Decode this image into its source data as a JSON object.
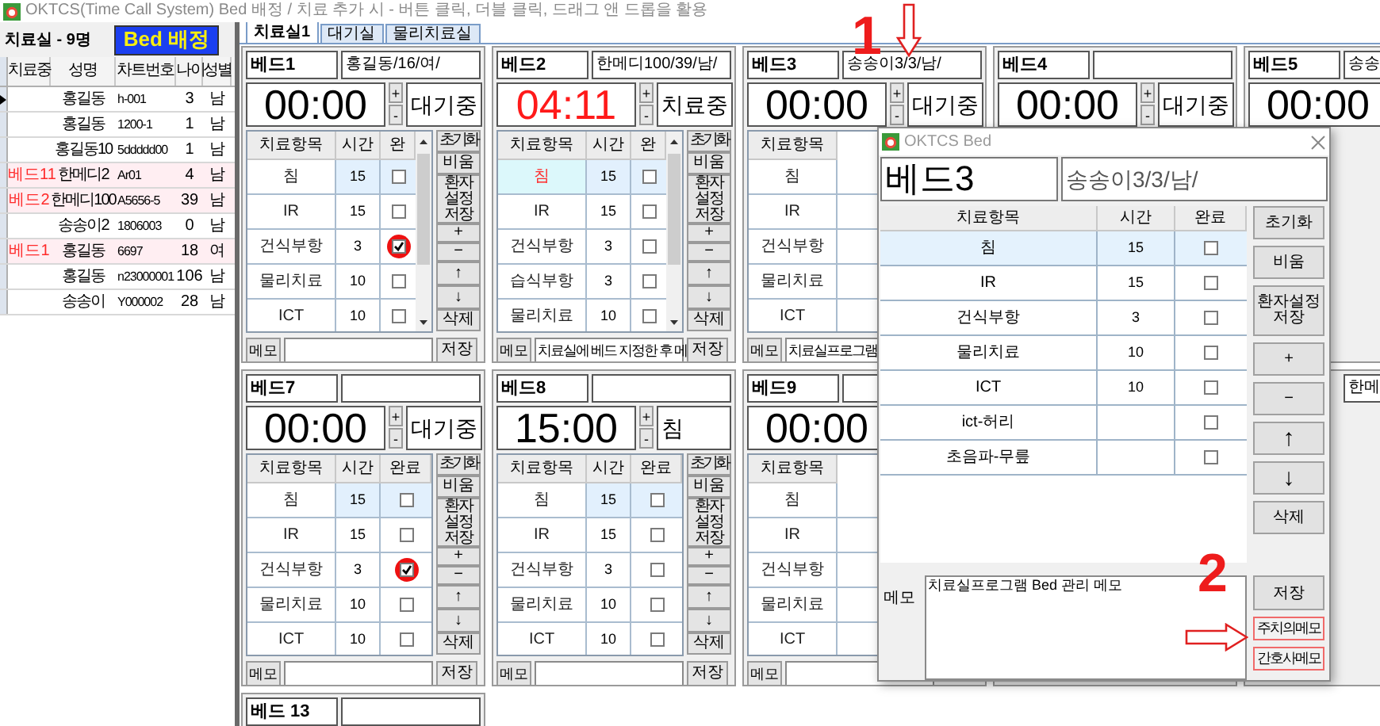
{
  "window": {
    "title": "OKTCS(Time Call System)  Bed 배정 / 치료 추가 시 - 버튼 클릭, 더블 클릭, 드래그 앤 드롭을 활용"
  },
  "patients": {
    "title": "치료실 - 9명",
    "assign_button": "Bed 배정",
    "columns": [
      "치료중",
      "성명",
      "차트번호",
      "나이",
      "성별"
    ],
    "rows": [
      {
        "name": "홍길동",
        "chart": "h-001",
        "age": "3",
        "sex": "남",
        "selected": true
      },
      {
        "name": "홍길동",
        "chart": "1200-1",
        "age": "1",
        "sex": "남",
        "selected": false
      },
      {
        "name": "홍길동10",
        "chart": "5ddddd00",
        "age": "1",
        "sex": "남",
        "selected": false
      },
      {
        "bed": "베드11",
        "name": "한메디2",
        "chart": "Ar01",
        "age": "4",
        "sex": "남",
        "selected": false
      },
      {
        "bed": "베드2",
        "name": "한메디100",
        "chart": "A5656-5",
        "age": "39",
        "sex": "남",
        "selected": false
      },
      {
        "name": "송송이2",
        "chart": "1806003",
        "age": "0",
        "sex": "남",
        "selected": false
      },
      {
        "bed": "베드1",
        "name": "홍길동",
        "chart": "6697",
        "age": "18",
        "sex": "여",
        "selected": false
      },
      {
        "name": "홍길동",
        "chart": "n23000001",
        "age": "106",
        "sex": "남",
        "selected": false
      },
      {
        "name": "송송이",
        "chart": "Y000002",
        "age": "28",
        "sex": "남",
        "selected": false
      }
    ]
  },
  "tabs": [
    {
      "label": "치료실1",
      "selected": true
    },
    {
      "label": "대기실",
      "selected": false
    },
    {
      "label": "물리치료실",
      "selected": false
    }
  ],
  "bed_rows": [
    [
      {
        "bed": "베드1",
        "patient": "홍길동/16/여/",
        "timer": "00:00",
        "running": false,
        "spin": [
          "+",
          "-"
        ],
        "status": "대기중",
        "columns": [
          "치료항목",
          "시간",
          "완"
        ],
        "scrollbar": true,
        "items": [
          {
            "name": "침",
            "time": "15",
            "checked": false,
            "selected": true,
            "circled": false
          },
          {
            "name": "IR",
            "time": "15",
            "checked": false,
            "selected": false,
            "circled": false
          },
          {
            "name": "건식부항",
            "time": "3",
            "checked": true,
            "selected": false,
            "circled": true
          },
          {
            "name": "물리치료",
            "time": "10",
            "checked": false,
            "selected": false,
            "circled": false
          },
          {
            "name": "ICT",
            "time": "10",
            "checked": false,
            "selected": false,
            "circled": false
          }
        ],
        "buttons": [
          "초기화",
          "비움",
          "환자설정저장",
          "+",
          "−",
          "↑",
          "↓",
          "삭제"
        ],
        "memo_label": "메모",
        "save": "저장"
      },
      {
        "bed": "베드2",
        "patient": "한메디100/39/남/",
        "timer": "04:11",
        "running": true,
        "spin": [
          "+",
          "-"
        ],
        "status": "치료중",
        "columns": [
          "치료항목",
          "시간",
          "완"
        ],
        "scrollbar": true,
        "items": [
          {
            "name": "침",
            "time": "15",
            "checked": false,
            "selected": true,
            "circled": false
          },
          {
            "name": "IR",
            "time": "15",
            "checked": false,
            "selected": false,
            "circled": false
          },
          {
            "name": "건식부항",
            "time": "3",
            "checked": false,
            "selected": false,
            "circled": false
          },
          {
            "name": "습식부항",
            "time": "3",
            "checked": false,
            "selected": false,
            "circled": false
          },
          {
            "name": "물리치료",
            "time": "10",
            "checked": false,
            "selected": false,
            "circled": false
          }
        ],
        "buttons": [
          "초기화",
          "비움",
          "환자설정저장",
          "+",
          "−",
          "↑",
          "↓",
          "삭제"
        ],
        "memo_label": "메모",
        "memo": "치료실에 베드 지정한 후 메",
        "save": "저장"
      },
      {
        "bed": "베드3",
        "patient": "송송이3/3/남/",
        "timer": "00:00",
        "running": false,
        "spin": [
          "+",
          "-"
        ],
        "status": "대기중",
        "columns": [
          "치료항목"
        ],
        "items": [
          {
            "name": "침"
          },
          {
            "name": "IR"
          },
          {
            "name": "건식부항"
          },
          {
            "name": "물리치료"
          },
          {
            "name": "ICT"
          }
        ],
        "memo_label": "메모",
        "memo": "치료실프로그램"
      },
      {
        "bed": "베드4",
        "timer": "00:00",
        "running": false,
        "spin": [
          "+",
          "-"
        ],
        "status": "대기중"
      },
      {
        "bed": "베드5",
        "patient": "송송",
        "timer": "00:00",
        "running": false
      }
    ],
    [
      {
        "bed": "베드7",
        "timer": "00:00",
        "running": false,
        "spin": [
          "+",
          "-"
        ],
        "status": "대기중",
        "columns": [
          "치료항목",
          "시간",
          "완료"
        ],
        "scrollbar": false,
        "items": [
          {
            "name": "침",
            "time": "15",
            "checked": false,
            "selected": true,
            "circled": false
          },
          {
            "name": "IR",
            "time": "15",
            "checked": false,
            "selected": false,
            "circled": false
          },
          {
            "name": "건식부항",
            "time": "3",
            "checked": true,
            "selected": false,
            "circled": true
          },
          {
            "name": "물리치료",
            "time": "10",
            "checked": false,
            "selected": false,
            "circled": false
          },
          {
            "name": "ICT",
            "time": "10",
            "checked": false,
            "selected": false,
            "circled": false
          }
        ],
        "buttons": [
          "초기화",
          "비움",
          "환자설정저장",
          "+",
          "−",
          "↑",
          "↓",
          "삭제"
        ],
        "memo_label": "메모",
        "save": "저장"
      },
      {
        "bed": "베드8",
        "timer": "15:00",
        "running": false,
        "spin": [
          "+",
          "-"
        ],
        "status": "침",
        "columns": [
          "치료항목",
          "시간",
          "완료"
        ],
        "scrollbar": false,
        "items": [
          {
            "name": "침",
            "time": "15",
            "checked": false,
            "selected": true,
            "circled": false
          },
          {
            "name": "IR",
            "time": "15",
            "checked": false,
            "selected": false,
            "circled": false
          },
          {
            "name": "건식부항",
            "time": "3",
            "checked": false,
            "selected": false,
            "circled": false
          },
          {
            "name": "물리치료",
            "time": "10",
            "checked": false,
            "selected": false,
            "circled": false
          },
          {
            "name": "ICT",
            "time": "10",
            "checked": false,
            "selected": false,
            "circled": false
          }
        ],
        "buttons": [
          "초기화",
          "비움",
          "환자설정저장",
          "+",
          "−",
          "↑",
          "↓",
          "삭제"
        ],
        "memo_label": "메모",
        "save": "저장"
      },
      {
        "bed": "베드9",
        "timer": "00:00",
        "running": false,
        "columns": [
          "치료항목"
        ],
        "items": [
          {
            "name": "침"
          },
          {
            "name": "IR"
          },
          {
            "name": "건식부항"
          },
          {
            "name": "물리치료"
          },
          {
            "name": "ICT"
          }
        ],
        "memo_label": "메모"
      },
      {},
      {
        "patient": "한메"
      }
    ],
    [
      {
        "bed": "베드 13"
      }
    ]
  ],
  "dialog": {
    "title": "OKTCS Bed",
    "bed": "베드3",
    "patient": "송송이3/3/남/",
    "columns": [
      "치료항목",
      "시간",
      "완료"
    ],
    "items": [
      {
        "name": "침",
        "time": "15",
        "checked": false,
        "selected": true
      },
      {
        "name": "IR",
        "time": "15",
        "checked": false,
        "selected": false
      },
      {
        "name": "건식부항",
        "time": "3",
        "checked": false,
        "selected": false
      },
      {
        "name": "물리치료",
        "time": "10",
        "checked": false,
        "selected": false
      },
      {
        "name": "ICT",
        "time": "10",
        "checked": false,
        "selected": false
      },
      {
        "name": "ict-허리",
        "checked": false,
        "selected": false
      },
      {
        "name": "초음파-무릎",
        "checked": false,
        "selected": false
      }
    ],
    "buttons": [
      "초기화",
      "비움",
      "환자설정저장",
      "+",
      "−",
      "↑",
      "↓",
      "삭제"
    ],
    "memo_label": "메모",
    "memo": "치료실프로그램 Bed 관리 메모",
    "save": "저장",
    "memo_buttons": [
      "주치의메모",
      "간호사메모"
    ]
  },
  "annotations": [
    {
      "text": "1"
    },
    {
      "text": "2"
    }
  ]
}
